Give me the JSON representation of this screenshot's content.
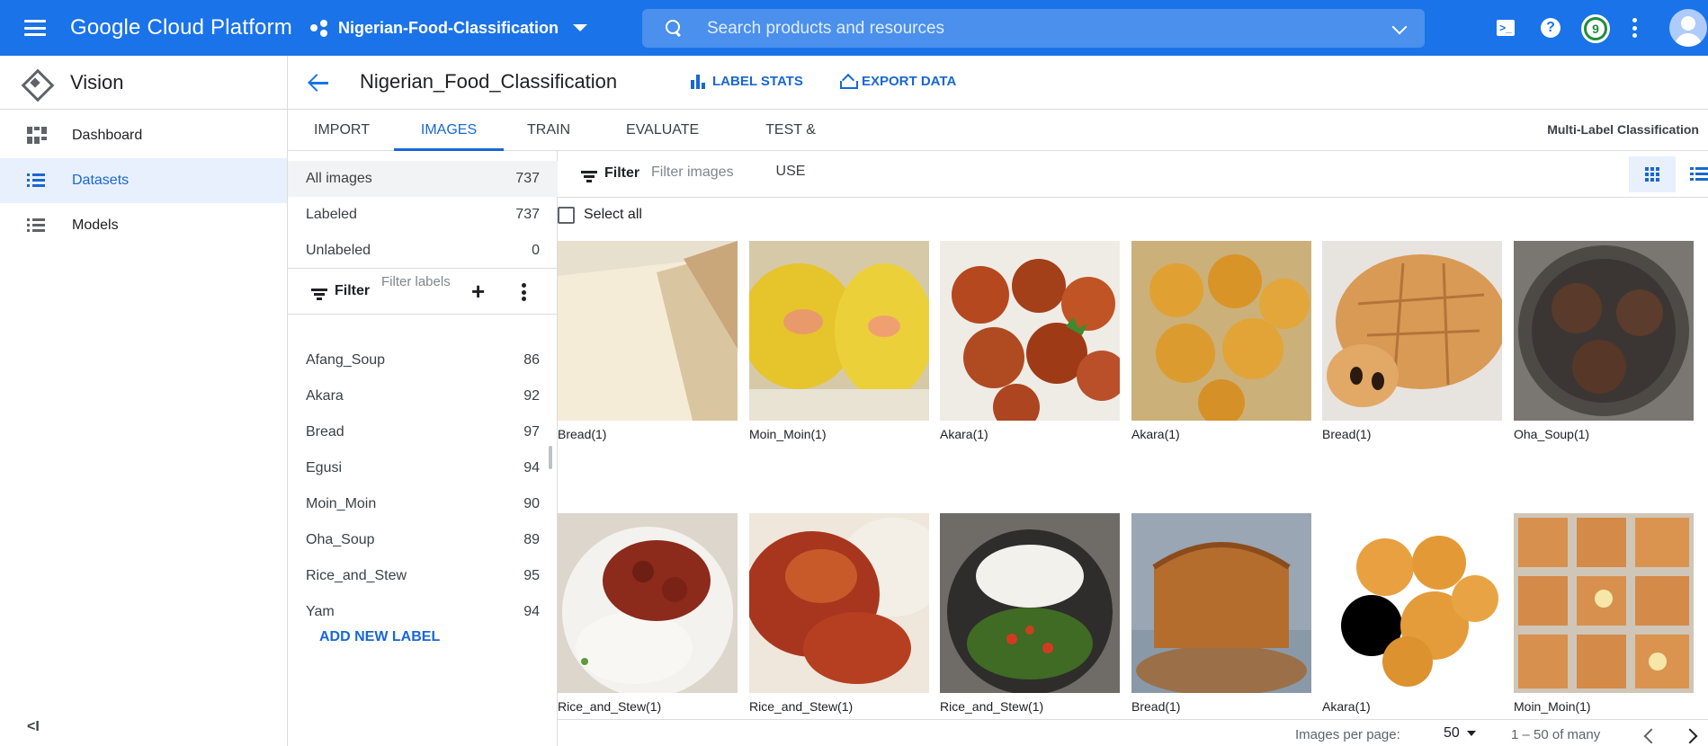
{
  "topbar": {
    "brand": "Google Cloud Platform",
    "project": "Nigerian-Food-Classification",
    "search_placeholder": "Search products and resources",
    "notification_count": "9",
    "color": "#1a73e8"
  },
  "sidebar": {
    "product": "Vision",
    "items": [
      {
        "label": "Dashboard",
        "icon": "dashboard-icon",
        "active": false
      },
      {
        "label": "Datasets",
        "icon": "list-icon",
        "active": true
      },
      {
        "label": "Models",
        "icon": "list-icon",
        "active": false
      }
    ],
    "collapse_glyph": "<I"
  },
  "header": {
    "title": "Nigerian_Food_Classification",
    "label_stats": "LABEL STATS",
    "export_data": "EXPORT DATA"
  },
  "tabs": {
    "items": [
      "IMPORT",
      "IMAGES",
      "TRAIN",
      "EVALUATE",
      "TEST & USE"
    ],
    "active": "IMAGES",
    "mode": "Multi-Label Classification"
  },
  "counts": [
    {
      "label": "All images",
      "count": "737"
    },
    {
      "label": "Labeled",
      "count": "737"
    },
    {
      "label": "Unlabeled",
      "count": "0"
    }
  ],
  "label_filter": {
    "label": "Filter",
    "placeholder": "Filter labels"
  },
  "labels": [
    {
      "name": "Afang_Soup",
      "count": "86"
    },
    {
      "name": "Akara",
      "count": "92"
    },
    {
      "name": "Bread",
      "count": "97"
    },
    {
      "name": "Egusi",
      "count": "94"
    },
    {
      "name": "Moin_Moin",
      "count": "90"
    },
    {
      "name": "Oha_Soup",
      "count": "89"
    },
    {
      "name": "Rice_and_Stew",
      "count": "95"
    },
    {
      "name": "Yam",
      "count": "94"
    }
  ],
  "add_label": "ADD NEW LABEL",
  "image_filter": {
    "label": "Filter",
    "placeholder": "Filter images",
    "select_all": "Select all"
  },
  "images": [
    {
      "caption": "Bread(1)",
      "kind": "bread-slices"
    },
    {
      "caption": "Moin_Moin(1)",
      "kind": "moin-moin"
    },
    {
      "caption": "Akara(1)",
      "kind": "akara-dark"
    },
    {
      "caption": "Akara(1)",
      "kind": "akara-light"
    },
    {
      "caption": "Bread(1)",
      "kind": "turtle-bread"
    },
    {
      "caption": "Oha_Soup(1)",
      "kind": "pot"
    },
    {
      "caption": "Rice_and_Stew(1)",
      "kind": "rice-plate"
    },
    {
      "caption": "Rice_and_Stew(1)",
      "kind": "chicken-stew"
    },
    {
      "caption": "Rice_and_Stew(1)",
      "kind": "rice-veg"
    },
    {
      "caption": "Bread(1)",
      "kind": "loaf"
    },
    {
      "caption": "Akara(1)",
      "kind": "akara-white"
    },
    {
      "caption": "Moin_Moin(1)",
      "kind": "moin-trays"
    }
  ],
  "pagination": {
    "per_page_label": "Images per page:",
    "per_page": "50",
    "range": "1 – 50 of many"
  }
}
